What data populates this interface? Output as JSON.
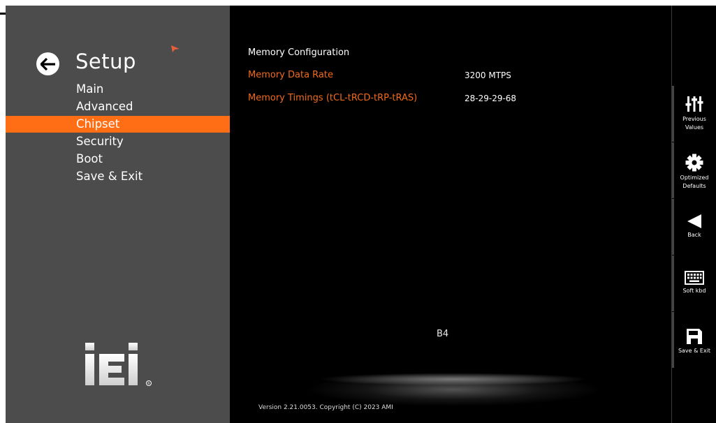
{
  "sidebar": {
    "title": "Setup",
    "items": [
      {
        "label": "Main"
      },
      {
        "label": "Advanced"
      },
      {
        "label": "Chipset"
      },
      {
        "label": "Security"
      },
      {
        "label": "Boot"
      },
      {
        "label": "Save & Exit"
      }
    ],
    "active_index": 2,
    "logo_text": "iEi"
  },
  "main": {
    "section_title": "Memory Configuration",
    "rows": [
      {
        "label": "Memory Data Rate",
        "value": "3200 MTPS"
      },
      {
        "label": "Memory Timings (tCL-tRCD-tRP-tRAS)",
        "value": "28-29-29-68"
      }
    ],
    "post_code": "B4",
    "version": "Version 2.21.0053. Copyright (C) 2023 AMI"
  },
  "toolbar": {
    "items": [
      {
        "label_line1": "Previous",
        "label_line2": "Values",
        "icon": "sliders-icon"
      },
      {
        "label_line1": "Optimized",
        "label_line2": "Defaults",
        "icon": "gear-icon"
      },
      {
        "label_line1": "Back",
        "label_line2": "",
        "icon": "back-triangle-icon"
      },
      {
        "label_line1": "Soft kbd",
        "label_line2": "",
        "icon": "keyboard-icon"
      },
      {
        "label_line1": "Save & Exit",
        "label_line2": "",
        "icon": "floppy-disk-icon"
      }
    ]
  },
  "colors": {
    "accent": "#ff6e14",
    "item_label": "#f26a1b",
    "sidebar_bg": "#4c4c4c",
    "main_bg": "#000000"
  }
}
